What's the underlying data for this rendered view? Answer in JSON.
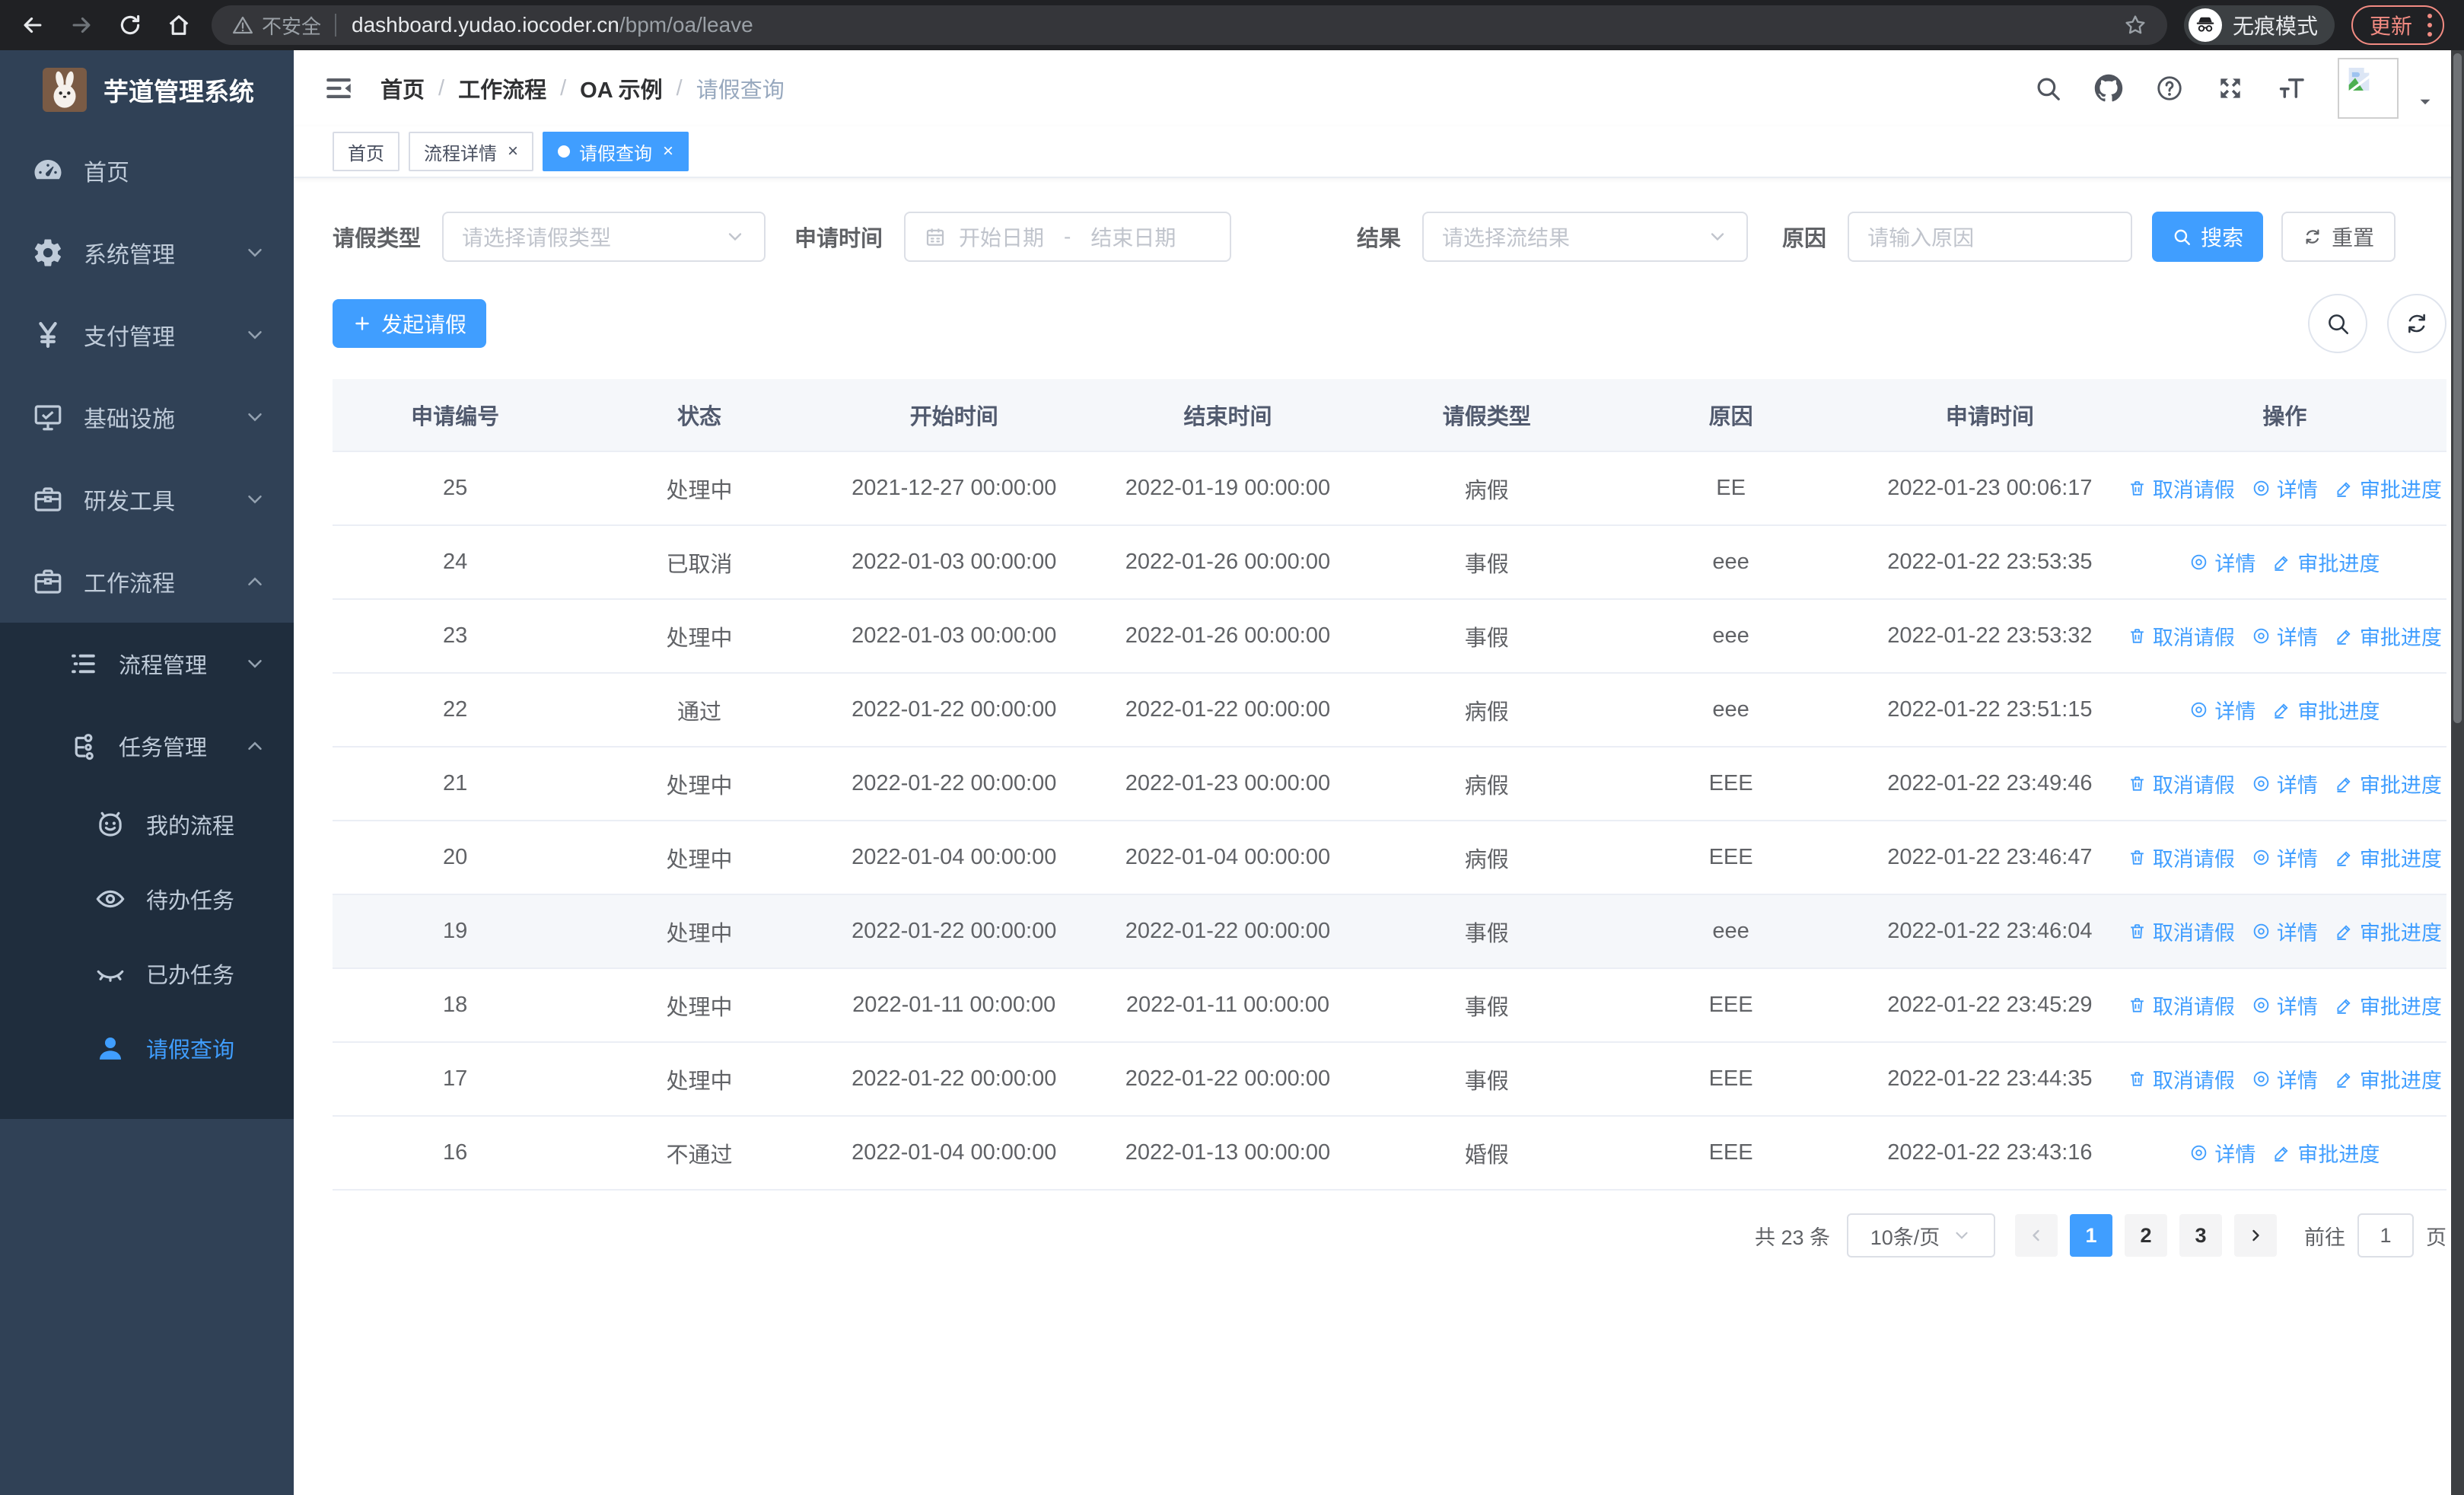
{
  "browser": {
    "security_label": "不安全",
    "url_host": "dashboard.yudao.iocoder.cn",
    "url_path": "/bpm/oa/leave",
    "incognito_label": "无痕模式",
    "update_label": "更新"
  },
  "sidebar": {
    "title": "芋道管理系统",
    "menu": [
      {
        "label": "首页",
        "icon": "dashboard-icon",
        "level": 1
      },
      {
        "label": "系统管理",
        "icon": "gear-icon",
        "level": 1,
        "chevron": "down"
      },
      {
        "label": "支付管理",
        "icon": "yen-icon",
        "level": 1,
        "chevron": "down"
      },
      {
        "label": "基础设施",
        "icon": "monitor-icon",
        "level": 1,
        "chevron": "down"
      },
      {
        "label": "研发工具",
        "icon": "toolbox-icon",
        "level": 1,
        "chevron": "down"
      },
      {
        "label": "工作流程",
        "icon": "briefcase-icon",
        "level": 1,
        "chevron": "up"
      },
      {
        "label": "流程管理",
        "icon": "list-icon",
        "level": 2,
        "chevron": "down"
      },
      {
        "label": "任务管理",
        "icon": "flow-icon",
        "level": 2,
        "chevron": "up"
      },
      {
        "label": "我的流程",
        "icon": "robot-icon",
        "level": 3
      },
      {
        "label": "待办任务",
        "icon": "eye-open-icon",
        "level": 3
      },
      {
        "label": "已办任务",
        "icon": "eye-closed-icon",
        "level": 3
      },
      {
        "label": "请假查询",
        "icon": "user-icon",
        "level": 3,
        "active": true
      }
    ]
  },
  "navbar": {
    "breadcrumb": [
      "首页",
      "工作流程",
      "OA 示例",
      "请假查询"
    ]
  },
  "tags": [
    {
      "label": "首页",
      "closable": false,
      "active": false
    },
    {
      "label": "流程详情",
      "closable": true,
      "active": false
    },
    {
      "label": "请假查询",
      "closable": true,
      "active": true
    }
  ],
  "filters": {
    "leave_type_label": "请假类型",
    "leave_type_placeholder": "请选择请假类型",
    "apply_time_label": "申请时间",
    "start_date_placeholder": "开始日期",
    "date_separator": "-",
    "end_date_placeholder": "结束日期",
    "result_label": "结果",
    "result_placeholder": "请选择流结果",
    "reason_label": "原因",
    "reason_placeholder": "请输入原因",
    "search_label": "搜索",
    "reset_label": "重置"
  },
  "toolbar": {
    "create_label": "发起请假"
  },
  "table": {
    "columns": [
      "申请编号",
      "状态",
      "开始时间",
      "结束时间",
      "请假类型",
      "原因",
      "申请时间",
      "操作"
    ],
    "action_labels": {
      "cancel": "取消请假",
      "detail": "详情",
      "progress": "审批进度"
    },
    "rows": [
      {
        "id": "25",
        "status": "处理中",
        "start": "2021-12-27 00:00:00",
        "end": "2022-01-19 00:00:00",
        "type": "病假",
        "reason": "EE",
        "applied": "2022-01-23 00:06:17",
        "actions": [
          "cancel",
          "detail",
          "progress"
        ]
      },
      {
        "id": "24",
        "status": "已取消",
        "start": "2022-01-03 00:00:00",
        "end": "2022-01-26 00:00:00",
        "type": "事假",
        "reason": "eee",
        "applied": "2022-01-22 23:53:35",
        "actions": [
          "detail",
          "progress"
        ]
      },
      {
        "id": "23",
        "status": "处理中",
        "start": "2022-01-03 00:00:00",
        "end": "2022-01-26 00:00:00",
        "type": "事假",
        "reason": "eee",
        "applied": "2022-01-22 23:53:32",
        "actions": [
          "cancel",
          "detail",
          "progress"
        ]
      },
      {
        "id": "22",
        "status": "通过",
        "start": "2022-01-22 00:00:00",
        "end": "2022-01-22 00:00:00",
        "type": "病假",
        "reason": "eee",
        "applied": "2022-01-22 23:51:15",
        "actions": [
          "detail",
          "progress"
        ]
      },
      {
        "id": "21",
        "status": "处理中",
        "start": "2022-01-22 00:00:00",
        "end": "2022-01-23 00:00:00",
        "type": "病假",
        "reason": "EEE",
        "applied": "2022-01-22 23:49:46",
        "actions": [
          "cancel",
          "detail",
          "progress"
        ]
      },
      {
        "id": "20",
        "status": "处理中",
        "start": "2022-01-04 00:00:00",
        "end": "2022-01-04 00:00:00",
        "type": "病假",
        "reason": "EEE",
        "applied": "2022-01-22 23:46:47",
        "actions": [
          "cancel",
          "detail",
          "progress"
        ]
      },
      {
        "id": "19",
        "status": "处理中",
        "start": "2022-01-22 00:00:00",
        "end": "2022-01-22 00:00:00",
        "type": "事假",
        "reason": "eee",
        "applied": "2022-01-22 23:46:04",
        "actions": [
          "cancel",
          "detail",
          "progress"
        ],
        "hover": true
      },
      {
        "id": "18",
        "status": "处理中",
        "start": "2022-01-11 00:00:00",
        "end": "2022-01-11 00:00:00",
        "type": "事假",
        "reason": "EEE",
        "applied": "2022-01-22 23:45:29",
        "actions": [
          "cancel",
          "detail",
          "progress"
        ]
      },
      {
        "id": "17",
        "status": "处理中",
        "start": "2022-01-22 00:00:00",
        "end": "2022-01-22 00:00:00",
        "type": "事假",
        "reason": "EEE",
        "applied": "2022-01-22 23:44:35",
        "actions": [
          "cancel",
          "detail",
          "progress"
        ]
      },
      {
        "id": "16",
        "status": "不通过",
        "start": "2022-01-04 00:00:00",
        "end": "2022-01-13 00:00:00",
        "type": "婚假",
        "reason": "EEE",
        "applied": "2022-01-22 23:43:16",
        "actions": [
          "detail",
          "progress"
        ]
      }
    ]
  },
  "pagination": {
    "total_label": "共 23 条",
    "page_size": "10条/页",
    "pages": [
      "1",
      "2",
      "3"
    ],
    "active_page": "1",
    "goto_label": "前往",
    "goto_value": "1",
    "page_label": "页"
  },
  "colors": {
    "accent": "#409eff",
    "sidebar_bg": "#304156",
    "submenu_bg": "#1f2d3d",
    "chrome_coral": "#f28b82"
  }
}
